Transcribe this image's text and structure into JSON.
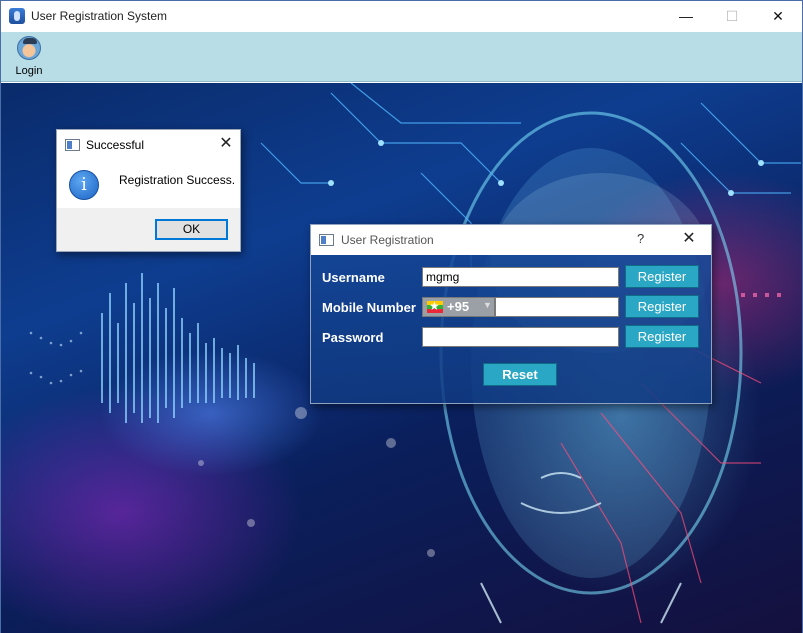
{
  "window": {
    "title": "User Registration System",
    "minimize_glyph": "—",
    "maximize_glyph": "☐",
    "close_glyph": "✕"
  },
  "toolbar": {
    "login_label": "Login",
    "login_icon": "user-avatar-icon"
  },
  "message_box": {
    "title": "Successful",
    "close_glyph": "✕",
    "icon": "info-icon",
    "icon_glyph": "i",
    "message": "Registration Success.",
    "ok_label": "OK"
  },
  "registration_dialog": {
    "title": "User Registration",
    "help_glyph": "?",
    "close_glyph": "✕",
    "username_label": "Username",
    "username_value": "mgmg",
    "mobile_label": "Mobile Number",
    "country_code": "+95",
    "country_flag": "myanmar-flag-icon",
    "mobile_value": "",
    "password_label": "Password",
    "password_value": "",
    "register_label": "Register",
    "reset_label": "Reset"
  },
  "colors": {
    "toolbar_bg": "#b9dde6",
    "button_teal": "#2aa7c4",
    "dialog_body": "#1c4a94",
    "focus_border": "#0078d7"
  }
}
